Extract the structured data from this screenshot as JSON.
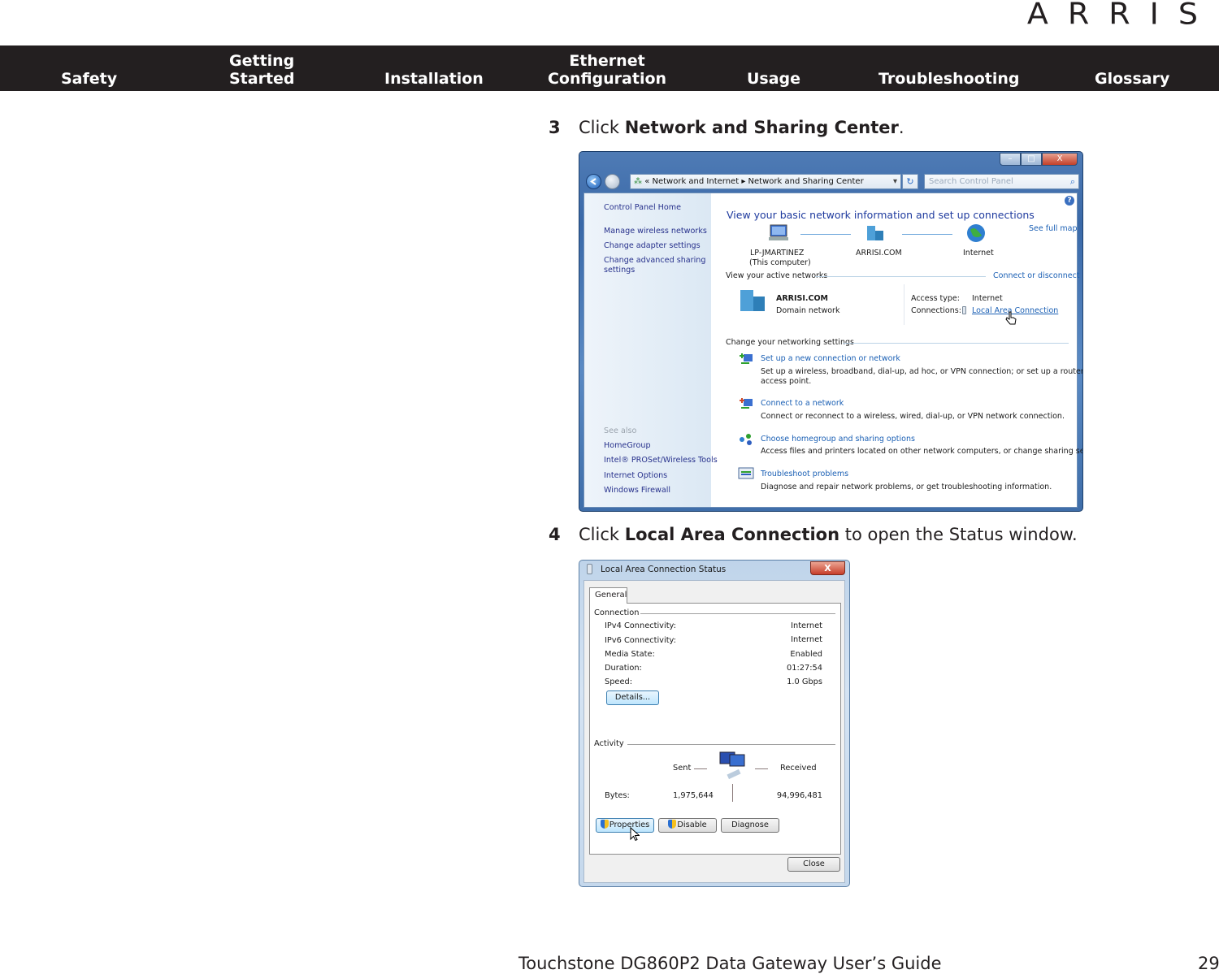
{
  "brand": {
    "logo_text": "ARRIS"
  },
  "nav": {
    "items": [
      {
        "line1": "",
        "line2": "Safety"
      },
      {
        "line1": "Getting",
        "line2": "Started"
      },
      {
        "line1": "",
        "line2": "Installation"
      },
      {
        "line1": "Ethernet",
        "line2": "Configuration"
      },
      {
        "line1": "",
        "line2": "Usage"
      },
      {
        "line1": "",
        "line2": "Troubleshooting"
      },
      {
        "line1": "",
        "line2": "Glossary"
      }
    ]
  },
  "steps": [
    {
      "number": "3",
      "prefix": "Click ",
      "bold": "Network and Sharing Center",
      "suffix": "."
    },
    {
      "number": "4",
      "prefix": "Click ",
      "bold": "Local Area Connection",
      "suffix": " to open the Status window."
    }
  ],
  "sharing_center": {
    "caption_buttons": {
      "minimize": "–",
      "maximize": "□",
      "close": "X"
    },
    "address": {
      "chevron": "«",
      "crumb1": "Network and Internet",
      "separator": "▸",
      "crumb2": "Network and Sharing Center",
      "dropdown": "▾"
    },
    "refresh_icon": "↻",
    "search_placeholder": "Search Control Panel",
    "search_icon": "⌕",
    "left_links": [
      "Control Panel Home",
      "Manage wireless networks",
      "Change adapter settings",
      "Change advanced sharing",
      "settings"
    ],
    "see_also_label": "See also",
    "see_also_links": [
      "HomeGroup",
      "Intel® PROSet/Wireless Tools",
      "Internet Options",
      "Windows Firewall"
    ],
    "heading": "View your basic network information and set up connections",
    "see_full_map": "See full map",
    "map_nodes": [
      {
        "label": "LP-JMARTINEZ",
        "sublabel": "(This computer)"
      },
      {
        "label": "ARRISI.COM",
        "sublabel": ""
      },
      {
        "label": "Internet",
        "sublabel": ""
      }
    ],
    "active_networks_label": "View your active networks",
    "connect_or_disconnect": "Connect or disconnect",
    "active_network": {
      "name": "ARRISI.COM",
      "type": "Domain network",
      "access_type_label": "Access type:",
      "access_type_value": "Internet",
      "connections_label": "Connections:",
      "connections_value": "Local Area Connection"
    },
    "change_settings_label": "Change your networking settings",
    "tasks": [
      {
        "title": "Set up a new connection or network",
        "desc1": "Set up a wireless, broadband, dial-up, ad hoc, or VPN connection; or set up a router or",
        "desc2": "access point."
      },
      {
        "title": "Connect to a network",
        "desc1": "Connect or reconnect to a wireless, wired, dial-up, or VPN network connection.",
        "desc2": ""
      },
      {
        "title": "Choose homegroup and sharing options",
        "desc1": "Access files and printers located on other network computers, or change sharing settings.",
        "desc2": ""
      },
      {
        "title": "Troubleshoot problems",
        "desc1": "Diagnose and repair network problems, or get troubleshooting information.",
        "desc2": ""
      }
    ]
  },
  "status_window": {
    "title": "Local Area Connection Status",
    "close_glyph": "X",
    "tab": "General",
    "connection_label": "Connection",
    "rows": [
      {
        "label": "IPv4 Connectivity:",
        "value": "Internet"
      },
      {
        "label": "IPv6 Connectivity:",
        "value": "Internet"
      },
      {
        "label": "Media State:",
        "value": "Enabled"
      },
      {
        "label": "Duration:",
        "value": "01:27:54"
      },
      {
        "label": "Speed:",
        "value": "1.0 Gbps"
      }
    ],
    "details_button": "Details...",
    "activity_label": "Activity",
    "sent_label": "Sent",
    "received_label": "Received",
    "bytes_label": "Bytes:",
    "bytes_sent": "1,975,644",
    "bytes_received": "94,996,481",
    "buttons": {
      "properties": "Properties",
      "disable": "Disable",
      "diagnose": "Diagnose",
      "close": "Close"
    }
  },
  "footer": {
    "guide_title": "Touchstone DG860P2 Data Gateway User’s Guide",
    "page_number": "29"
  }
}
